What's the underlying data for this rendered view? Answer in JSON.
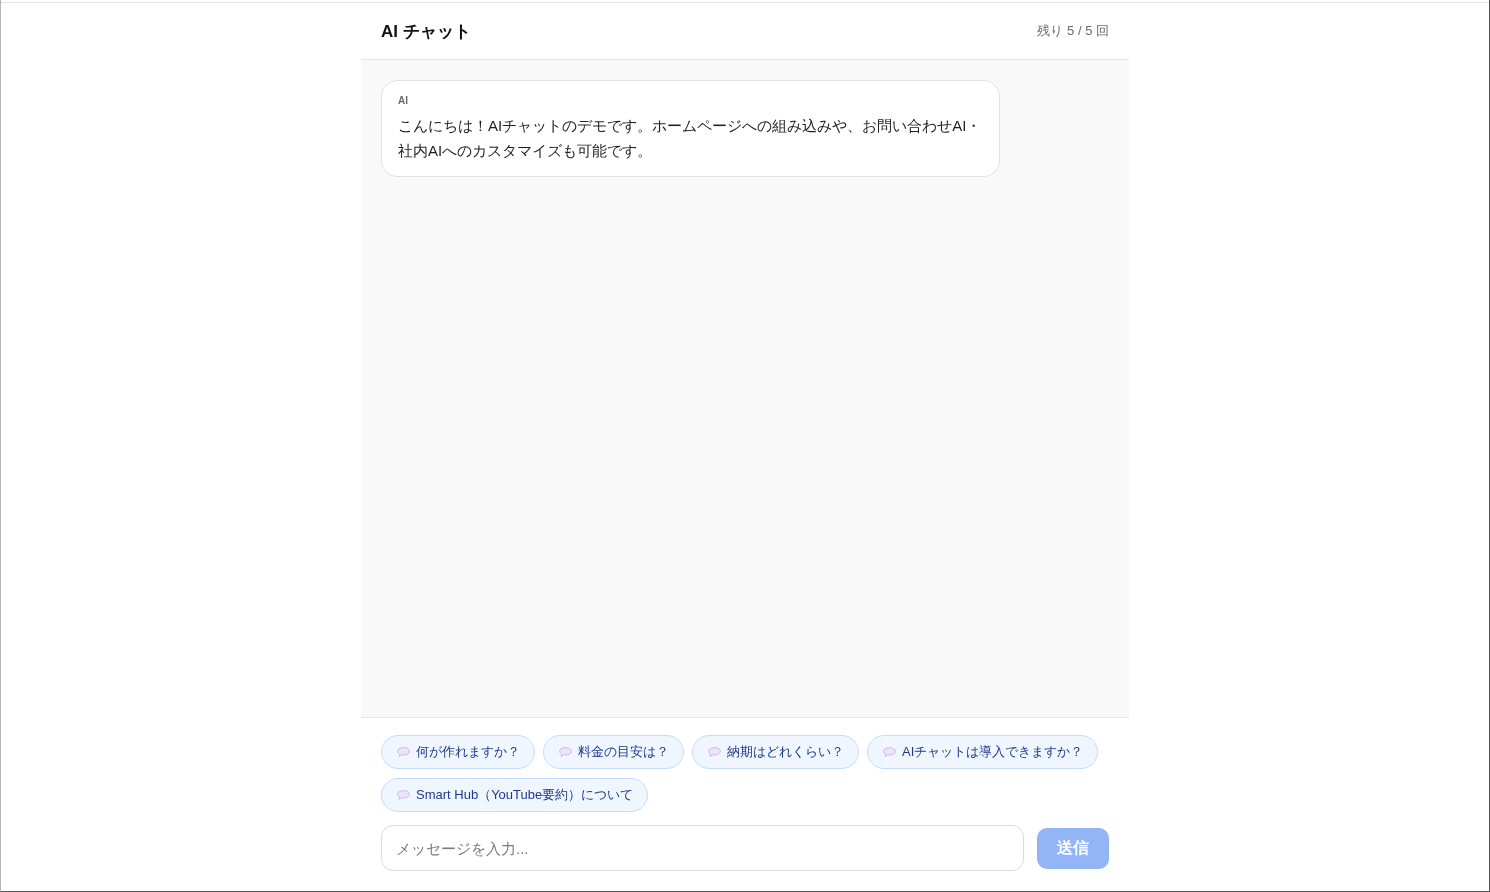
{
  "header": {
    "title": "AI チャット",
    "remaining": "残り 5 / 5 回"
  },
  "messages": [
    {
      "kind": "ai",
      "sender": "AI",
      "text": "こんにちは！AIチャットのデモです。ホームページへの組み込みや、お問い合わせAI・社内AIへのカスタマイズも可能です。"
    }
  ],
  "suggestions": [
    {
      "label": "何が作れますか？"
    },
    {
      "label": "料金の目安は？"
    },
    {
      "label": "納期はどれくらい？"
    },
    {
      "label": "AIチャットは導入できますか？"
    },
    {
      "label": "Smart Hub（YouTube要約）について"
    }
  ],
  "composer": {
    "placeholder": "メッセージを入力...",
    "send_button": {
      "label": "送信",
      "disabled": true
    }
  }
}
